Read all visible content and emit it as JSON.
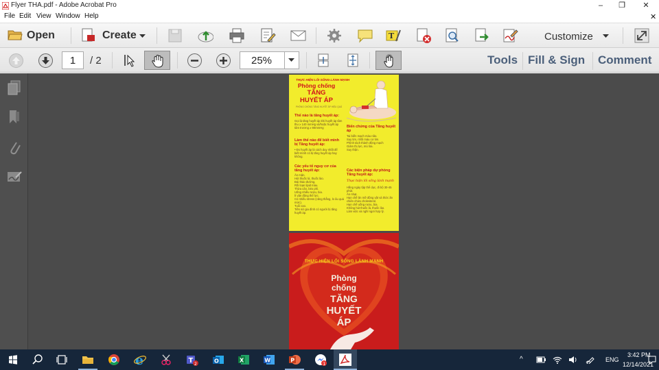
{
  "window": {
    "title": "Flyer THA.pdf - Adobe Acrobat Pro",
    "minimize": "–",
    "restore": "❐",
    "close": "✕"
  },
  "menubar": {
    "items": [
      "File",
      "Edit",
      "View",
      "Window",
      "Help"
    ],
    "close": "✕"
  },
  "toolbar": {
    "open_label": "Open",
    "create_label": "Create",
    "customize_label": "Customize"
  },
  "navbar": {
    "current_page": "1",
    "total_pages": "/ 2",
    "zoom": "25%",
    "tools_label": "Tools",
    "fillsign_label": "Fill & Sign",
    "comment_label": "Comment"
  },
  "document": {
    "page1": {
      "banner": "THỰC HIỆN LỐI SỐNG LÀNH MẠNH",
      "title_line1": "Phòng chống",
      "title_line2": "TĂNG",
      "title_line3": "HUYẾT ÁP",
      "sub": "PHÒNG CHỐNG TĂNG HUYẾT ÁP HIỆU QUẢ",
      "s1_title": "Thế nào là tăng huyết áp:",
      "s1_body": "Gọi là tăng huyết áp khi huyết áp tâm thu ≥ 140 mmHg và/hoặc huyết áp tâm trương ≥ 90mmHg",
      "s2_title": "Làm thế nào để biết mình bị Tăng huyết áp:",
      "s2_body": "• Đo huyết áp là cách duy nhất để biết mình có bị tăng huyết áp hay không.",
      "s3_title": "Các yếu tố nguy cơ của tăng huyết áp:",
      "s3_items": [
        "Ăn mặn.",
        "Hút thuốc lá, thuốc lào.",
        "Đái tháo đường.",
        "Rối loạn lipid máu.",
        "Thừa cân, béo phì.",
        "Uống nhiều rượu, bia.",
        "Ít vận động thể lực.",
        "Có nhiều stress (căng thẳng, lo âu quá mức).",
        "Tuổi cao.",
        "Tiền sử gia đình có người bị tăng huyết áp."
      ],
      "s4_title": "Biến chứng của Tăng huyết áp",
      "s4_items": [
        "Tai biến mạch máu não.",
        "Suy tim, nhồi máu cơ tim.",
        "Phình tách thành động mạch",
        "Giảm thị lực, mù lòa.",
        "Suy thận."
      ],
      "s5_title": "Các biện pháp dự phòng Tăng huyết áp:",
      "s5_script": "Thực hiện lối sống lành mạnh",
      "s5_items": [
        "Hằng ngày tập thể dục, đi bộ 30-45 phút.",
        "Ăn nhạt.",
        "Hạn chế ăn mỡ động vật và thức ăn chiên chứa cholesterol.",
        "Hạn chế uống rượu, bia.",
        "Không hút thuốc lá, thuốc lào.",
        "Làm việc và nghỉ ngơi hợp lý."
      ]
    },
    "page2": {
      "banner": "THỰC HIỆN LỐI SỐNG LÀNH MẠNH",
      "line1": "Phòng",
      "line2": "chống",
      "line3": "TĂNG",
      "line4": "HUYẾT",
      "line5": "ÁP"
    }
  },
  "taskbar": {
    "time": "3:42 PM",
    "date": "12/14/2021",
    "lang": "ENG"
  },
  "colors": {
    "flyer_yellow": "#f2ec2c",
    "flyer_red": "#d0121a",
    "link_blue": "#4b5f7a",
    "taskbar": "#16263a"
  }
}
